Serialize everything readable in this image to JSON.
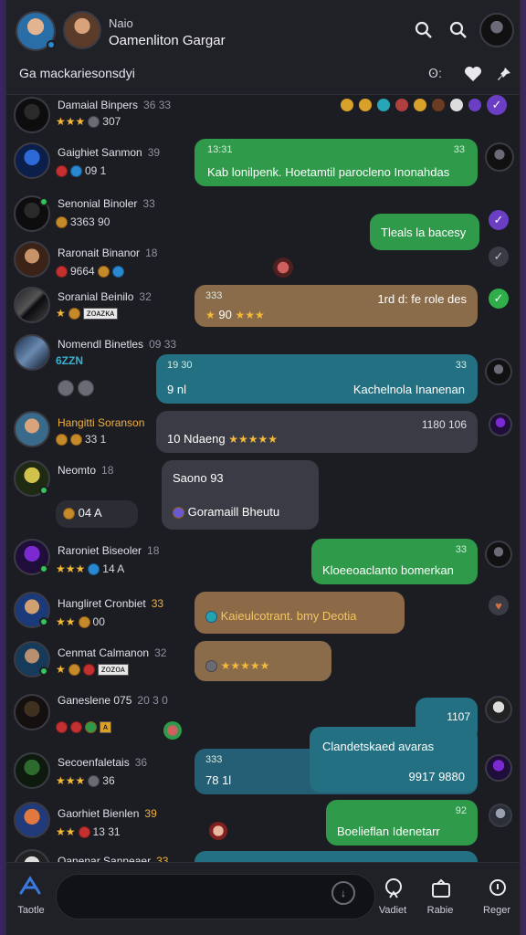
{
  "header": {
    "title": "Naio",
    "subtitle": "Oamenliton Gargar",
    "status": "Ga mackariesonsdyi",
    "count": "Ꙩ:"
  },
  "chats": [
    {
      "name": "Damaial Binpers",
      "time": "36 33",
      "meta": "307"
    },
    {
      "name": "Gaighiet Sanmon",
      "time": "39",
      "meta": "09 1",
      "bubble_time": "13:31",
      "bubble_count": "33",
      "bubble": "Kab lonilpenk. Hoetamtil parocleno Inonahdas"
    },
    {
      "name": "Senonial Binoler",
      "time": "33",
      "meta": "3363 90",
      "bubble": "Tleals la bacesy"
    },
    {
      "name": "Raronait Binanor",
      "time": "18",
      "meta": "9664"
    },
    {
      "name": "Soranial Beinilo",
      "time": "32",
      "meta": "ᴢᴏᴀᴢᴋᴀ",
      "bubble_time": "333",
      "bubble": "1rd d: fe role des",
      "bubble_stars": "90"
    },
    {
      "name": "Nomendl Binetles",
      "time": "09 33",
      "meta": "6ZZN",
      "bubble_time": "19 30",
      "bubble_count": "33",
      "bubble_sub": "9 nl",
      "bubble": "Kachelnola Inanenan"
    },
    {
      "name": "Hangitti Soranson",
      "time": "",
      "meta": "33 1",
      "bubble": "10 Ndaeng",
      "bubble_count": "1180 106"
    },
    {
      "name": "Neomto",
      "time": "18",
      "meta": "04 A",
      "bubble": "Saono 93",
      "bubble_sub": "Goramaill Bheutu"
    },
    {
      "name": "Raroniet Biseoler",
      "time": "18",
      "meta": "14 A",
      "bubble_count": "33",
      "bubble": "Kloeeoaclanto bomerkan"
    },
    {
      "name": "Hangliret Cronbiet",
      "time": "33",
      "meta": "00",
      "bubble": "Kaieulcotrant. bmy Deotia"
    },
    {
      "name": "Cenmat Calmanon",
      "time": "32",
      "meta": "ᴢᴏᴢᴏᴀ"
    },
    {
      "name": "Ganeslene 075",
      "time": "20 3 0",
      "meta": "",
      "bubble_count": "1107"
    },
    {
      "name": "Secoenfaletais",
      "time": "36",
      "meta": "36",
      "bubble_time": "333",
      "bubble_sub": "78 1l",
      "bubble": "Clandetskaed avaras",
      "bubble_num": "9917 9880"
    },
    {
      "name": "Gaorhiet Bienlen",
      "time": "39",
      "meta": "13 31",
      "bubble_count": "92",
      "bubble": "Boelieflan Idenetarr"
    },
    {
      "name": "Oanenar Sanneaer",
      "time": "33",
      "meta": ""
    }
  ],
  "bottom": {
    "home_label": "Taotle",
    "nav1_label": "Vadiet",
    "nav2_label": "Rabie",
    "nav3_label": "Reger"
  },
  "colors": {
    "accent_green": "#2f9a4a",
    "accent_teal": "#227082",
    "background": "#1c1d22"
  }
}
